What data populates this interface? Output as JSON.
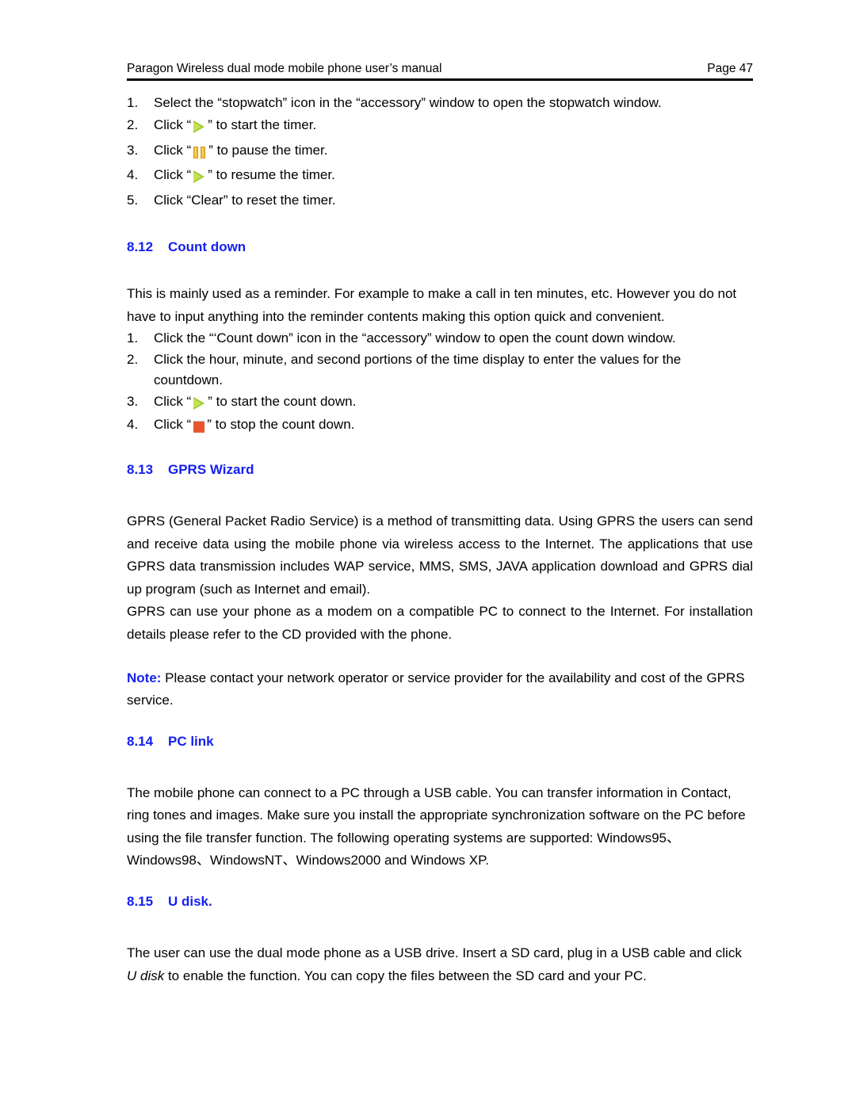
{
  "header": {
    "left": "Paragon Wireless dual mode mobile phone user’s manual",
    "right": "Page 47"
  },
  "stopwatch_steps": [
    {
      "num": "1.",
      "pre": "Select the “stopwatch” icon in the “accessory” window to open the stopwatch window.",
      "icon": "",
      "post": ""
    },
    {
      "num": "2.",
      "pre": "Click  “",
      "icon": "play-icon",
      "post": "” to start the timer."
    },
    {
      "num": "3.",
      "pre": "Click  “",
      "icon": "pause-icon",
      "post": "” to pause the timer."
    },
    {
      "num": "4.",
      "pre": "Click  “",
      "icon": "play-icon",
      "post": "” to resume the timer."
    },
    {
      "num": "5.",
      "pre": "Click “Clear” to reset the timer.",
      "icon": "",
      "post": ""
    }
  ],
  "section_812": {
    "number": "8.12",
    "title": "Count down",
    "intro": "This is mainly used as a reminder. For example to make a  call in ten minutes, etc. However you do not have to input anything into the reminder contents making this option quick and convenient.",
    "steps": [
      {
        "num": "1.",
        "pre": "Click the “‘Count down” icon in the “accessory” window to open the count down window.",
        "icon": "",
        "post": ""
      },
      {
        "num": "2.",
        "pre": "Click the hour, minute, and second portions of the time display to enter the values for the countdown.",
        "icon": "",
        "post": ""
      },
      {
        "num": "3.",
        "pre": "Click  “",
        "icon": "play-icon",
        "post": "” to start the count down."
      },
      {
        "num": "4.",
        "pre": "Click  “",
        "icon": "stop-icon",
        "post": "” to stop the count down."
      }
    ]
  },
  "section_813": {
    "number": "8.13",
    "title": "GPRS Wizard",
    "para1": "GPRS (General Packet Radio Service) is a method of transmitting data. Using GPRS the users can send and receive data using the mobile phone via wireless access to the Internet. The applications that use GPRS data transmission includes WAP service, MMS, SMS, JAVA application download and GPRS dial up program (such as Internet and email).",
    "para2": "GPRS can use your phone as a modem on a compatible PC to connect to the Internet. For installation details please refer to the CD provided with the phone.",
    "note_label": "Note:",
    "note_text": " Please contact your network operator or service provider for the availability and cost of the GPRS service."
  },
  "section_814": {
    "number": "8.14",
    "title": "PC link",
    "para1": " The mobile phone can connect to a PC through a USB cable. You can transfer information in Contact, ring tones and images. Make sure you install the appropriate synchronization software on the PC before using the file transfer function. The following operating systems are supported: Windows95、Windows98、WindowsNT、Windows2000 and Windows XP."
  },
  "section_815": {
    "number": "8.15",
    "title": "U disk.",
    "para_a": "The user can use the dual mode phone as a USB drive. Insert a SD card, plug in a USB cable and click ",
    "para_italic": "U disk",
    "para_b": " to enable the function. You can copy the files between the SD card and your PC."
  },
  "colors": {
    "heading_blue": "#1520f0",
    "play_icon_green": "#9acd32",
    "pause_icon_yellow": "#e8a825",
    "stop_icon_orange": "#e8552d",
    "text_black": "#000000"
  }
}
